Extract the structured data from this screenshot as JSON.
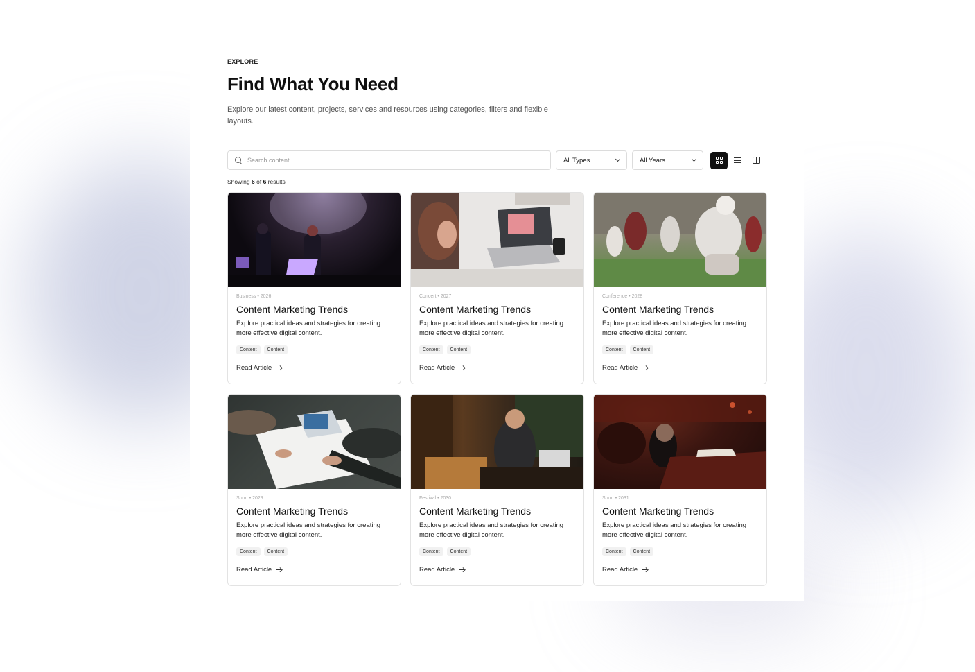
{
  "header": {
    "eyebrow": "EXPLORE",
    "title": "Find What You Need",
    "subtitle": "Explore our latest content, projects, services and resources using categories, filters and flexible layouts."
  },
  "toolbar": {
    "search_placeholder": "Search content...",
    "type_filter": "All Types",
    "year_filter": "All Years",
    "views": [
      "grid-view-icon",
      "list-view-icon",
      "split-view-icon"
    ],
    "active_view": "grid"
  },
  "results": {
    "prefix": "Showing",
    "shown": "6",
    "of": "of",
    "total": "6",
    "suffix": "results"
  },
  "cards": [
    {
      "category": "Business",
      "year": "2026",
      "title": "Content Marketing Trends",
      "description": "Explore practical ideas and strategies for creating more effective digital content.",
      "tags": [
        "Content",
        "Content"
      ],
      "cta": "Read Article",
      "image": "concert-performers-photo"
    },
    {
      "category": "Concert",
      "year": "2027",
      "title": "Content Marketing Trends",
      "description": "Explore practical ideas and strategies for creating more effective digital content.",
      "tags": [
        "Content",
        "Content"
      ],
      "cta": "Read Article",
      "image": "woman-laptop-meeting-photo"
    },
    {
      "category": "Conference",
      "year": "2028",
      "title": "Content Marketing Trends",
      "description": "Explore practical ideas and strategies for creating more effective digital content.",
      "tags": [
        "Content",
        "Content"
      ],
      "cta": "Read Article",
      "image": "football-players-photo"
    },
    {
      "category": "Sport",
      "year": "2029",
      "title": "Content Marketing Trends",
      "description": "Explore practical ideas and strategies for creating more effective digital content.",
      "tags": [
        "Content",
        "Content"
      ],
      "cta": "Read Article",
      "image": "team-pointing-at-documents-photo"
    },
    {
      "category": "Festival",
      "year": "2030",
      "title": "Content Marketing Trends",
      "description": "Explore practical ideas and strategies for creating more effective digital content.",
      "tags": [
        "Content",
        "Content"
      ],
      "cta": "Read Article",
      "image": "man-working-laptop-cafe-photo"
    },
    {
      "category": "Sport",
      "year": "2031",
      "title": "Content Marketing Trends",
      "description": "Explore practical ideas and strategies for creating more effective digital content.",
      "tags": [
        "Content",
        "Content"
      ],
      "cta": "Read Article",
      "image": "man-in-theater-photo"
    }
  ],
  "meta_separator": "•"
}
